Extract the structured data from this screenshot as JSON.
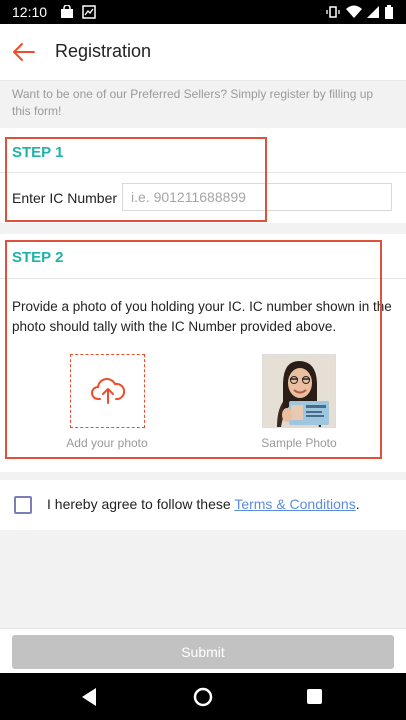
{
  "status_bar": {
    "time": "12:10"
  },
  "header": {
    "title": "Registration"
  },
  "intro": "Want to be one of our Preferred Sellers? Simply register by filling up this form!",
  "step1": {
    "label": "STEP 1",
    "ic_label": "Enter IC Number",
    "ic_placeholder": "i.e. 901211688899",
    "ic_value": ""
  },
  "step2": {
    "label": "STEP 2",
    "instructions": "Provide a photo of you holding your IC. IC number shown in the photo should tally with the IC Number provided above.",
    "upload_caption": "Add your photo",
    "sample_caption": "Sample Photo"
  },
  "agreement": {
    "text": "I hereby agree to follow these ",
    "link": "Terms & Conditions",
    "suffix": ".",
    "checked": false
  },
  "submit_label": "Submit",
  "colors": {
    "accent": "#ee4d2d",
    "step_label": "#1fb3a7",
    "link": "#5a8de0",
    "submit_disabled": "#c2c2c2"
  },
  "icons": [
    "back-arrow-icon",
    "cloud-upload-icon",
    "nav-back-icon",
    "nav-home-icon",
    "nav-recents-icon",
    "wifi-icon",
    "signal-icon",
    "battery-icon",
    "vibrate-icon"
  ]
}
